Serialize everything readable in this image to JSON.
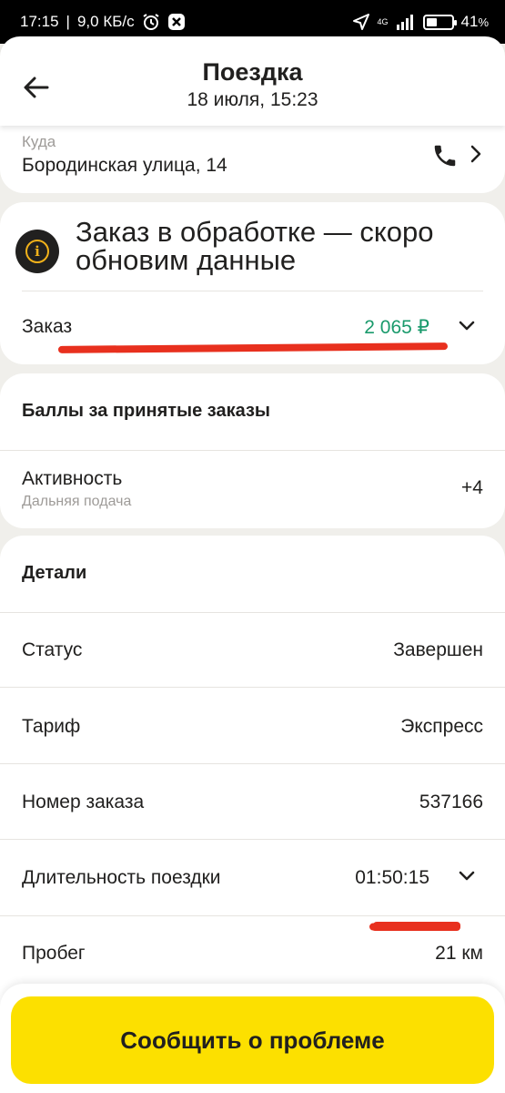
{
  "status_bar": {
    "time": "17:15",
    "network_speed": "9,0 КБ/с",
    "network_type": "4G",
    "battery": "41",
    "battery_unit": "%",
    "battery_level": 0.41
  },
  "header": {
    "title": "Поездка",
    "subtitle": "18 июля, 15:23"
  },
  "destination": {
    "label": "Куда",
    "address": "Бородинская улица, 14"
  },
  "order": {
    "status_text": "Заказ в обработке — скоро обновим данные",
    "label": "Заказ",
    "amount": "2 065 ₽"
  },
  "points": {
    "title": "Баллы за принятые заказы",
    "activity_label": "Активность",
    "activity_sub": "Дальняя подача",
    "activity_value": "+4"
  },
  "details": {
    "title": "Детали",
    "rows": [
      {
        "label": "Статус",
        "value": "Завершен"
      },
      {
        "label": "Тариф",
        "value": "Экспресс"
      },
      {
        "label": "Номер заказа",
        "value": "537166"
      },
      {
        "label": "Длительность поездки",
        "value": "01:50:15"
      },
      {
        "label": "Пробег",
        "value": "21 км"
      }
    ]
  },
  "bottom": {
    "report_label": "Сообщить о проблеме"
  },
  "colors": {
    "accent_yellow": "#fce000",
    "amount_green": "#1a9a6c",
    "annotation_red": "#e8301e",
    "info_icon_yellow": "#f2b21a"
  }
}
